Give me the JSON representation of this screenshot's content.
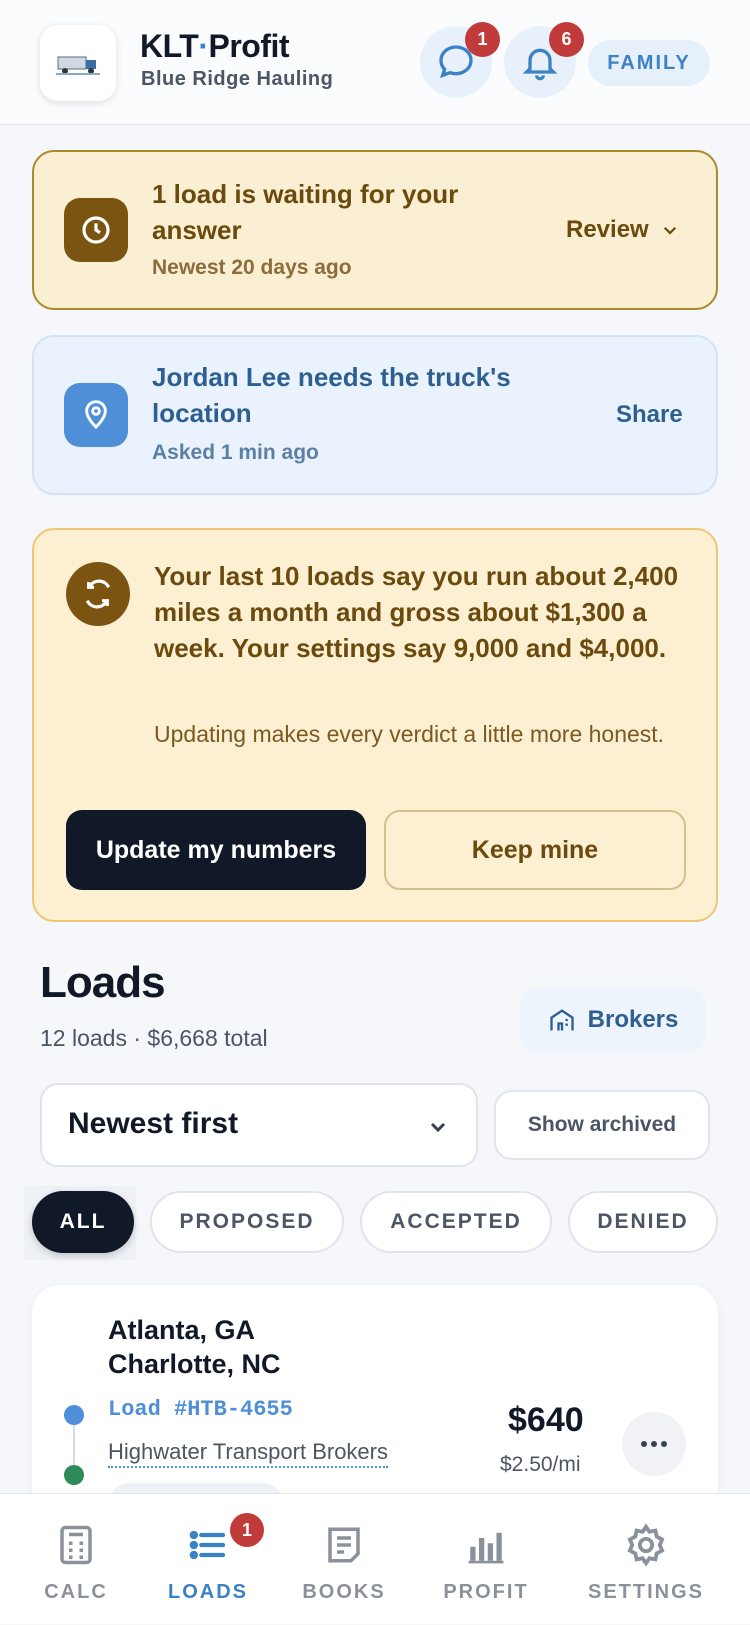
{
  "header": {
    "app_name_a": "KLT",
    "app_name_sep": "·",
    "app_name_b": "Profit",
    "company": "Blue Ridge Hauling",
    "messages_count": "1",
    "notifications_count": "6",
    "mode_chip": "FAMILY"
  },
  "alerts": {
    "waiting": {
      "title": "1 load is waiting for your answer",
      "subtitle": "Newest 20 days ago",
      "action": "Review"
    },
    "location": {
      "title": "Jordan Lee needs the truck's location",
      "subtitle": "Asked 1 min ago",
      "action": "Share"
    },
    "numbers": {
      "message": "Your last 10 loads say you run about 2,400 miles a month and gross about $1,300 a week. Your settings say 9,000 and $4,000.",
      "note": "Updating makes every verdict a little more honest.",
      "primary": "Update my numbers",
      "secondary": "Keep mine"
    }
  },
  "loads": {
    "title": "Loads",
    "summary": "12 loads · $6,668 total",
    "brokers_label": "Brokers",
    "sort_value": "Newest first",
    "archived_label": "Show archived",
    "filters": [
      "ALL",
      "PROPOSED",
      "ACCEPTED",
      "DENIED"
    ],
    "active_filter": "ALL",
    "items": [
      {
        "origin": "Atlanta, GA",
        "destination": "Charlotte, NC",
        "load_id": "Load #HTB-4655",
        "broker": "Highwater Transport Brokers",
        "price": "$640",
        "rate": "$2.50/mi"
      }
    ]
  },
  "tabs": [
    {
      "label": "CALC",
      "icon": "calculator-icon"
    },
    {
      "label": "LOADS",
      "icon": "list-icon",
      "badge": "1"
    },
    {
      "label": "BOOKS",
      "icon": "document-icon"
    },
    {
      "label": "PROFIT",
      "icon": "bar-chart-icon"
    },
    {
      "label": "SETTINGS",
      "icon": "gear-icon"
    }
  ],
  "colors": {
    "accent": "#3b82c4",
    "badge": "#c23b3b",
    "amber_dark": "#7a5410",
    "ink": "#111827"
  }
}
